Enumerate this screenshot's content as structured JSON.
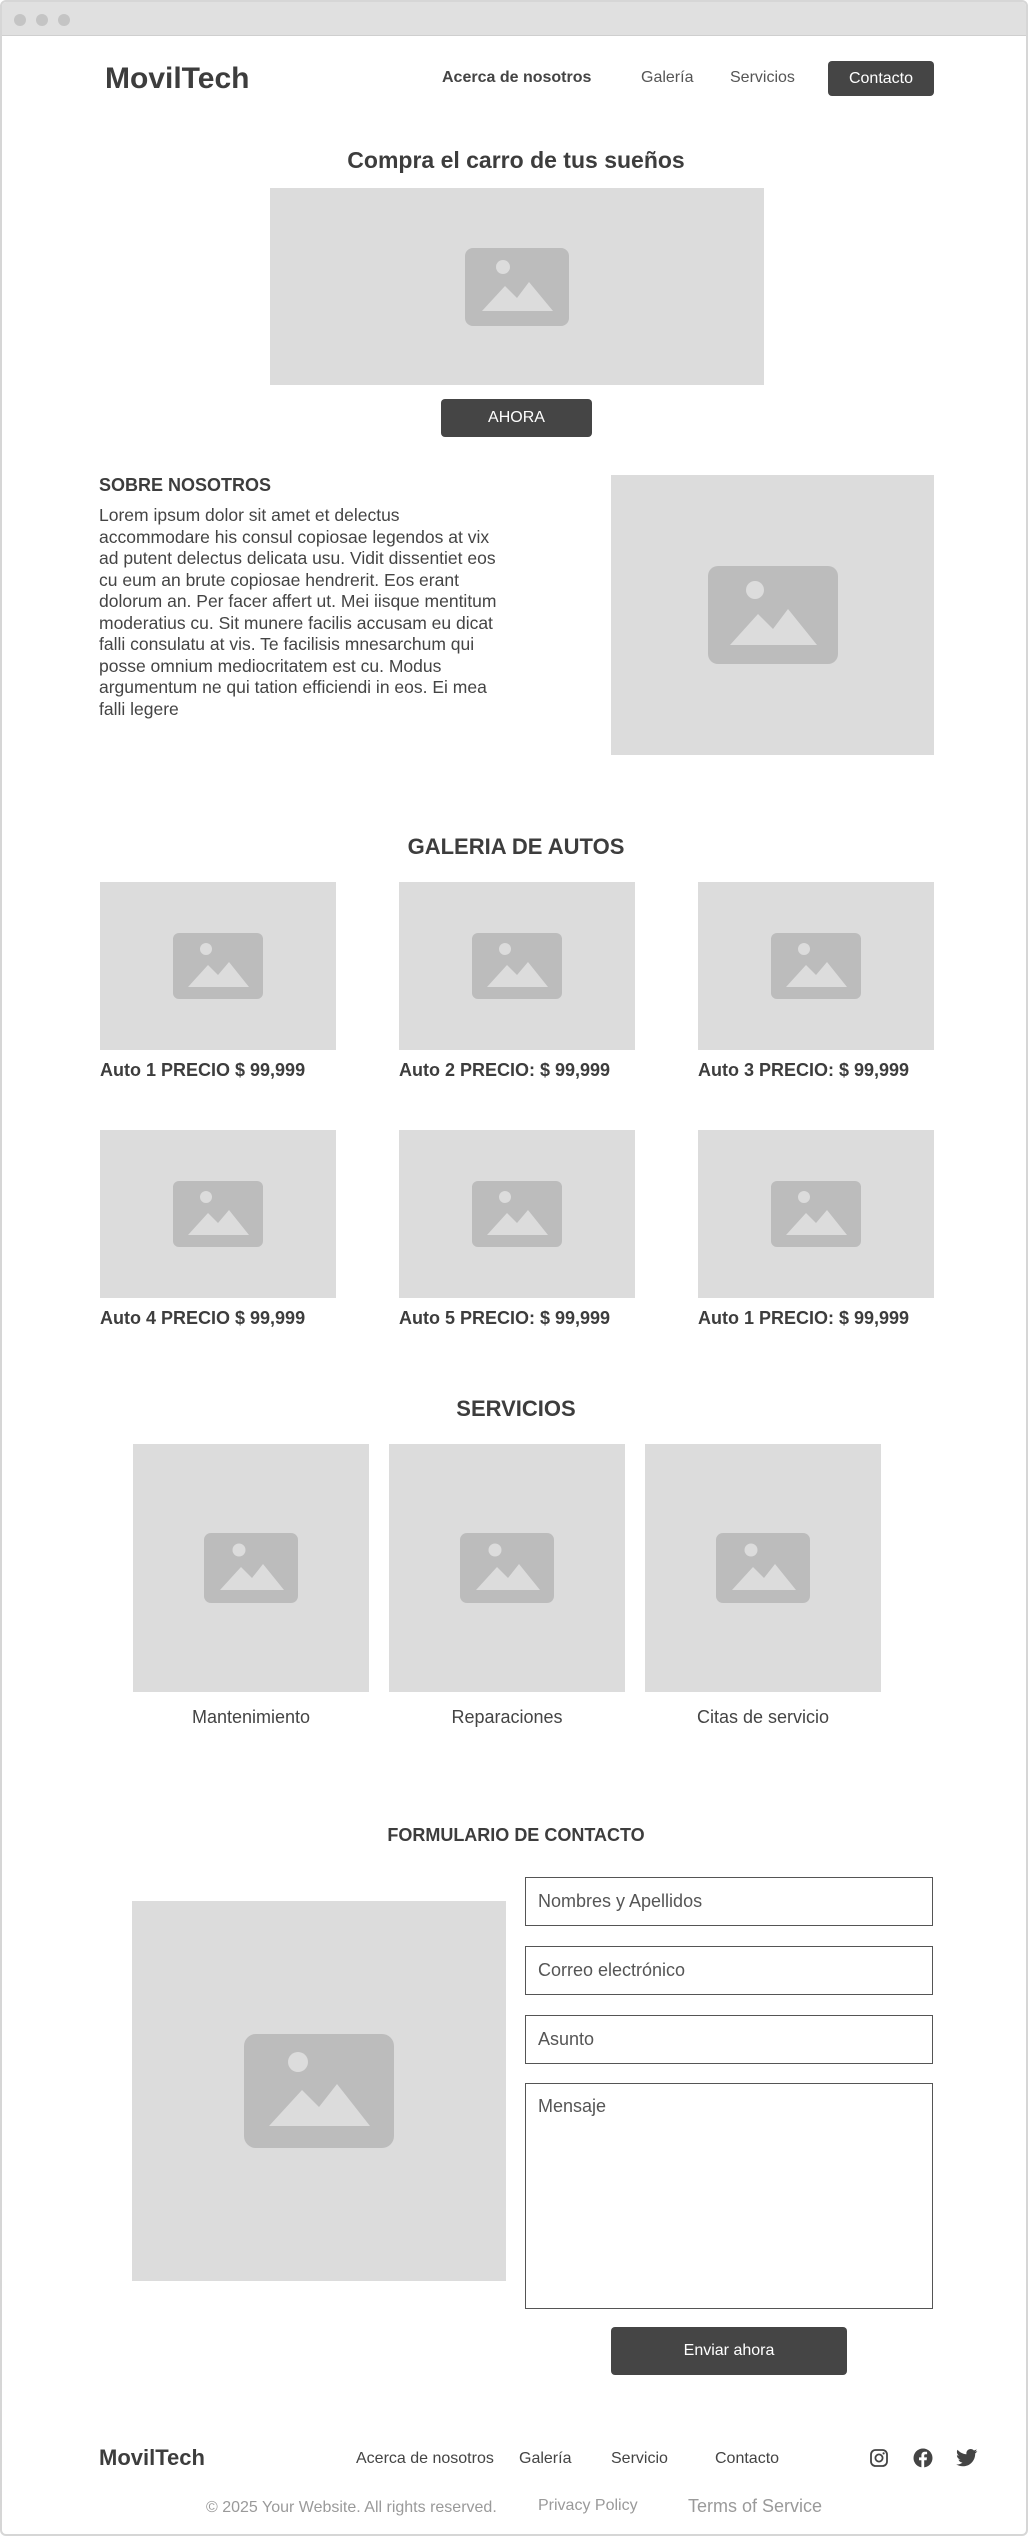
{
  "brand": "MovilTech",
  "nav": {
    "about": "Acerca de nosotros",
    "gallery": "Galería",
    "services": "Servicios",
    "contact": "Contacto"
  },
  "hero": {
    "title": "Compra el carro de tus sueños",
    "button": "AHORA"
  },
  "about": {
    "heading": "SOBRE NOSOTROS",
    "body": "Lorem ipsum dolor sit amet et delectus accommodare his consul copiosae legendos at vix ad putent delectus delicata usu. Vidit dissentiet eos cu eum an brute copiosae hendrerit. Eos erant dolorum an. Per facer affert ut. Mei iisque mentitum moderatius cu. Sit munere facilis accusam eu dicat falli consulatu at vis. Te facilisis mnesarchum qui posse omnium mediocritatem est cu. Modus argumentum ne qui tation efficiendi in eos. Ei mea falli legere"
  },
  "gallery": {
    "heading": "GALERIA DE AUTOS",
    "cars": [
      "Auto 1 PRECIO $ 99,999",
      "Auto 2 PRECIO: $ 99,999",
      "Auto 3 PRECIO: $ 99,999",
      "Auto 4 PRECIO $ 99,999",
      "Auto 5 PRECIO: $ 99,999",
      "Auto 1 PRECIO: $ 99,999"
    ]
  },
  "services": {
    "heading": "SERVICIOS",
    "items": [
      "Mantenimiento",
      "Reparaciones",
      "Citas de servicio"
    ]
  },
  "contact_form": {
    "heading": "FORMULARIO DE CONTACTO",
    "name_placeholder": "Nombres y Apellidos",
    "email_placeholder": "Correo electrónico",
    "subject_placeholder": "Asunto",
    "message_placeholder": "Mensaje",
    "submit": "Enviar ahora"
  },
  "footer": {
    "brand": "MovilTech",
    "nav": {
      "about": "Acerca de nosotros",
      "gallery": "Galería",
      "service": "Servicio",
      "contact": "Contacto"
    },
    "social_icons": [
      "instagram-icon",
      "facebook-icon",
      "twitter-icon"
    ],
    "copyright": "© 2025 Your Website. All rights reserved.",
    "privacy": "Privacy Policy",
    "terms": "Terms of Service"
  },
  "colors": {
    "placeholder_bg": "#dcdcdc",
    "placeholder_icon": "#b9b9b9",
    "dark_button": "#454545",
    "text": "#3d3d3d"
  }
}
